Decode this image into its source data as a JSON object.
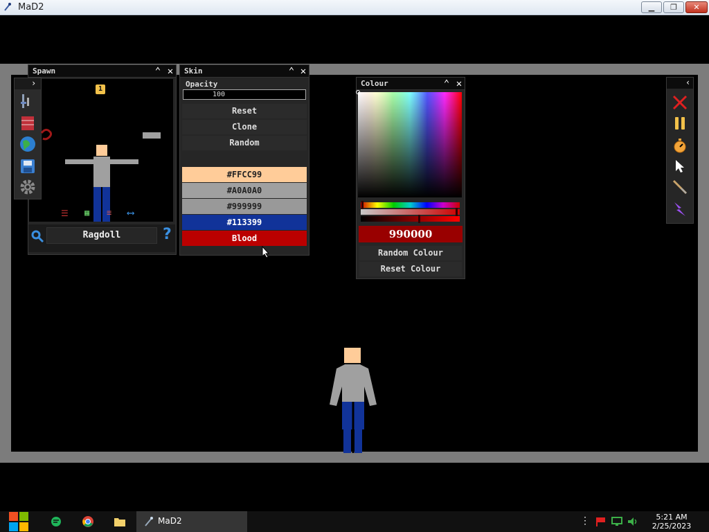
{
  "window": {
    "title": "MaD2"
  },
  "spawn": {
    "title": "Spawn",
    "badge": "1",
    "item_name": "Ragdoll",
    "help_glyph": "?"
  },
  "skin": {
    "title": "Skin",
    "opacity_label": "Opacity",
    "opacity_value": "100",
    "buttons": [
      "Reset",
      "Clone",
      "Random"
    ],
    "swatches": [
      {
        "label": "#FFCC99",
        "bg": "#FFCC99",
        "fg": "#222222"
      },
      {
        "label": "#A0A0A0",
        "bg": "#A0A0A0",
        "fg": "#222222"
      },
      {
        "label": "#999999",
        "bg": "#999999",
        "fg": "#222222"
      },
      {
        "label": "#113399",
        "bg": "#113399",
        "fg": "#ffffff"
      },
      {
        "label": "Blood",
        "bg": "#bb0000",
        "fg": "#ffffff"
      }
    ]
  },
  "colour": {
    "title": "Colour",
    "hex_value": "990000",
    "random_label": "Random Colour",
    "reset_label": "Reset Colour"
  },
  "taskbar": {
    "app_label": "MaD2",
    "time": "5:21 AM",
    "date": "2/25/2023"
  }
}
